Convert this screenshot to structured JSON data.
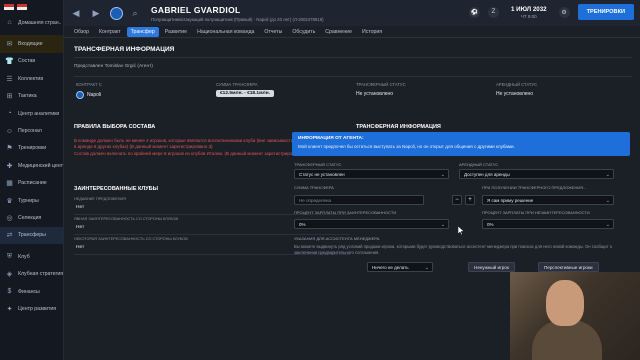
{
  "sidebar": {
    "items": [
      {
        "label": "Домашняя стран..",
        "icon": "home-icon"
      },
      {
        "label": "Входящие",
        "icon": "inbox-icon"
      },
      {
        "label": "Состав",
        "icon": "shirt-icon"
      },
      {
        "label": "Коллектив",
        "icon": "group-icon"
      },
      {
        "label": "Тактика",
        "icon": "tactics-icon"
      },
      {
        "label": "Центр аналитики",
        "icon": "analytics-icon"
      },
      {
        "label": "Персонал",
        "icon": "staff-icon"
      },
      {
        "label": "Тренировки",
        "icon": "training-icon"
      },
      {
        "label": "Медицинский центр",
        "icon": "medical-icon"
      },
      {
        "label": "Расписание",
        "icon": "calendar-icon"
      },
      {
        "label": "Турниры",
        "icon": "trophy-icon"
      },
      {
        "label": "Селекция",
        "icon": "scouting-icon"
      },
      {
        "label": "Трансферы",
        "icon": "transfers-icon"
      },
      {
        "label": "Клуб",
        "icon": "club-icon"
      },
      {
        "label": "Клубная стратегия",
        "icon": "strategy-icon"
      },
      {
        "label": "Финансы",
        "icon": "finance-icon"
      },
      {
        "label": "Центр развития",
        "icon": "development-icon"
      }
    ]
  },
  "header": {
    "player_name": "GABRIEL GVARDIOL",
    "player_sub": "Полузащитник/атакующий полузащитник (Правый) · Napoli (до 20 лет) (Л-2002478918)",
    "date": "1 ИЮЛ 2032",
    "time": "ЧТ 9:00",
    "train_button": "ТРЕНИРОВКИ"
  },
  "menu": {
    "items": [
      "Обзор",
      "Контракт",
      "Трансфер",
      "Развитие",
      "Национальная команда",
      "Отчеты",
      "Обсудить",
      "Сравнение",
      "История"
    ]
  },
  "transfer_info": {
    "title": "ТРАНСФЕРНАЯ ИНФОРМАЦИЯ",
    "represented": "Представлен Tomislav Grgić (Агент)",
    "contract_label": "КОНТРАКТ С",
    "club": "Napoli",
    "fee_label": "СУММА ТРАНСФЕРА",
    "fee_value": "€12.5млн. - €18.1млн.",
    "status_label": "ТРАНСФЕРНЫЙ СТАТУС",
    "status_value": "Не установлено",
    "loan_label": "АРЕНДНЫЙ СТАТУС",
    "loan_value": "Не установлено"
  },
  "rules": {
    "title": "ПРАВИЛА ВЫБОРА СОСТАВА",
    "text1": "В команде должно быть не менее 4 игроков, которые являются воспитанниками клуба (вне зависимости от времени, проведенном в аренде в других клубах) (В данный момент зарегистрировано 3)",
    "text2": "Состав должен включать по крайней мере 8 игроков из клубов Италии. (В данный момент зарегистрировано 5)"
  },
  "interested": {
    "title": "ЗАИНТЕРЕСОВАННЫЕ КЛУБЫ",
    "recent_label": "НЕДАВНИЕ ПРЕДЛОЖЕНИЯ",
    "date_col": "ДАТА ТРЕ...",
    "recent_value": "Нет",
    "strong_label": "ЯВНАЯ ЗАИНТЕРЕСОВАННОСТЬ СО СТОРОНЫ КЛУБОВ",
    "strong_value": "Нет",
    "some_label": "НЕКОТОРАЯ ЗАИНТЕРЕСОВАННОСТЬ СО СТОРОНЫ КЛУБОВ",
    "some_value": "Нет"
  },
  "right_panel": {
    "title": "ТРАНСФЕРНАЯ ИНФОРМАЦИЯ",
    "agent_title": "ИНФОРМАЦИЯ ОТ АГЕНТА:",
    "agent_text": "Мой клиент предпочел бы остаться выступать за Napoli, но он открыт для общения с другими клубами.",
    "status_label": "ТРАНСФЕРНЫЙ СТАТУС",
    "status_value": "Статус не установлен",
    "loan_label": "АРЕНДНЫЙ СТАТУС",
    "loan_value": "Доступен для аренды",
    "fee_label": "СУММА ТРАНСФЕРА",
    "fee_placeholder": "Не определена",
    "minus": "−",
    "plus": "+",
    "decision_label": "ПРИ ПОЛУЧЕНИИ ТРАНСФЕРНОГО ПРЕДЛОЖЕНИЯ...",
    "decision_value": "Я сам приму решение",
    "salary_inc_label": "ПРОЦЕНТ ЗАРПЛАТЫ ПРИ ЗАИНТЕРЕСОВАННОСТИ",
    "salary_inc_value": "0%",
    "salary_dec_label": "ПРОЦЕНТ ЗАРПЛАТЫ ПРИ НЕЗАИНТЕРЕСОВАННОСТИ",
    "salary_dec_value": "0%",
    "assistant_label": "УКАЗАНИЯ ДЛЯ АССИСТЕНТА МЕНЕДЖЕРА",
    "assistant_note": "Вы можете выдвинуть ряд условий продажи игрока, которыми будет руководствоваться ассистент менеджера при поисках для него новой команды. Он сообщит о заключении предварительного соглашения.",
    "action_value": "Ничего не делать",
    "btn_unwanted": "Ненужный игрок",
    "btn_prospective": "Перспективные игроки"
  }
}
